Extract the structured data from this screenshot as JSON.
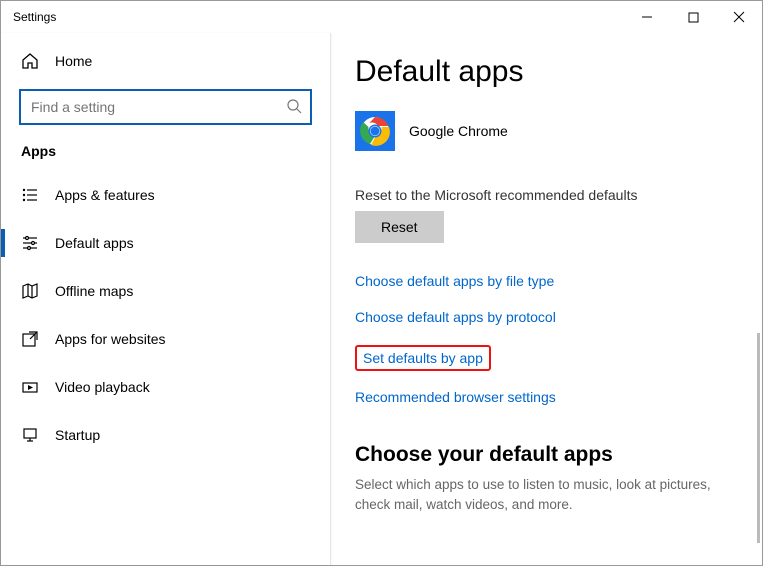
{
  "window": {
    "title": "Settings"
  },
  "sidebar": {
    "home_label": "Home",
    "search_placeholder": "Find a setting",
    "section_label": "Apps",
    "items": [
      {
        "label": "Apps & features"
      },
      {
        "label": "Default apps"
      },
      {
        "label": "Offline maps"
      },
      {
        "label": "Apps for websites"
      },
      {
        "label": "Video playback"
      },
      {
        "label": "Startup"
      }
    ]
  },
  "content": {
    "page_title": "Default apps",
    "current_app_label": "Google Chrome",
    "reset_label": "Reset to the Microsoft recommended defaults",
    "reset_button": "Reset",
    "links": {
      "by_file_type": "Choose default apps by file type",
      "by_protocol": "Choose default apps by protocol",
      "by_app": "Set defaults by app",
      "browser_settings": "Recommended browser settings"
    },
    "subsection_title": "Choose your default apps",
    "subsection_desc": "Select which apps to use to listen to music, look at pictures, check mail, watch videos, and more."
  }
}
